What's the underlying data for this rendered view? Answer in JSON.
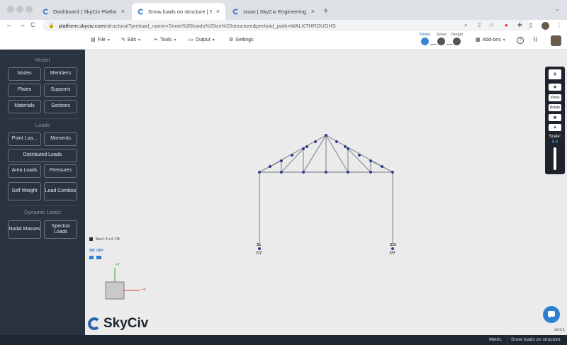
{
  "browser": {
    "tabs": [
      {
        "title": "Dashboard | SkyCiv Platform",
        "close": "×"
      },
      {
        "title": "Snow loads on structure | SkyC",
        "close": "×"
      },
      {
        "title": "snow | SkyCiv Engineering",
        "close": "×"
      }
    ],
    "new_tab": "+",
    "nav": {
      "back": "←",
      "forward": "→",
      "reload": "C"
    },
    "address": {
      "host": "platform.skyciv.com",
      "path": "/structural?preload_name=Snow%20loads%20on%20structure&preload_path=WALKTHROUGHS"
    }
  },
  "app_bar": {
    "menu": [
      {
        "label": "File",
        "icon": "file-icon"
      },
      {
        "label": "Edit",
        "icon": "pencil-icon"
      },
      {
        "label": "Tools",
        "icon": "wrench-icon"
      },
      {
        "label": "Output",
        "icon": "monitor-icon"
      },
      {
        "label": "Settings",
        "icon": "gear-icon"
      }
    ],
    "stages": [
      "Model",
      "Solve",
      "Design"
    ],
    "addons": "Add-ons",
    "help": "?"
  },
  "sidebar": {
    "sections": [
      {
        "title": "Model",
        "buttons": [
          "Nodes",
          "Members",
          "Plates",
          "Supports",
          "Materials",
          "Sections"
        ]
      },
      {
        "title": "Loads",
        "buttons": [
          "Point Loa...",
          "Moments",
          "Distributed Loads",
          "Area Loads",
          "Pressures",
          "Self Weight",
          "Load Combos"
        ]
      },
      {
        "title": "Dynamic Loads",
        "buttons": [
          "Nodal Masses",
          "Spectral Loads"
        ]
      }
    ],
    "logo": "SkyCiv"
  },
  "canvas": {
    "section_label": "Sec1: 5 x 6-7/8",
    "sr_label": "SR: OFF",
    "axis_y": "+Y",
    "axis_x": "+X",
    "support_labels": [
      "S1",
      "S10"
    ],
    "support_symbols": [
      "777",
      "777"
    ]
  },
  "right_toolbar": {
    "buttons": [
      "+",
      "eye-icon",
      "Views",
      "Rotate",
      "camera-icon",
      "cube-icon"
    ],
    "scale_label": "Scale:",
    "scale_value": "0.0"
  },
  "version": "v6.0.1",
  "status_bar": {
    "units": "Metric",
    "model_name": "Snow loads on structure"
  },
  "colors": {
    "sidebar": "#2b3240",
    "accent": "#2e7fd1",
    "member": "#7a7f87",
    "node": "#2c3e8f"
  }
}
